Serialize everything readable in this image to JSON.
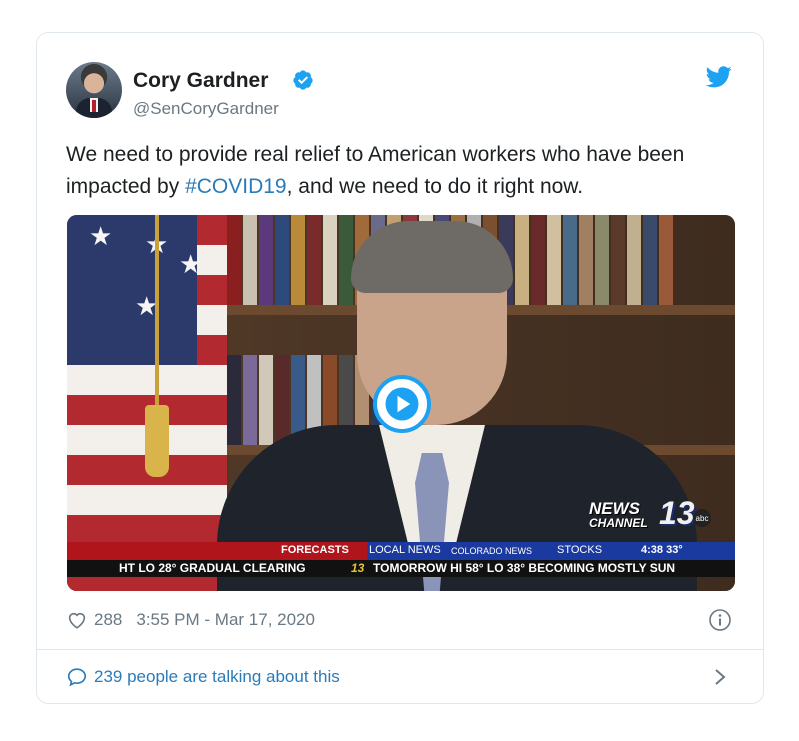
{
  "tweet": {
    "author_name": "Cory Gardner",
    "author_handle": "@SenCoryGardner",
    "text_before": "We need to provide real relief to American workers who have been impacted by ",
    "hashtag": "#COVID19",
    "text_after": ", and we need to do it right now.",
    "likes": "288",
    "timestamp": "3:55 PM - Mar 17, 2020",
    "talking": "239 people are talking about this"
  },
  "video": {
    "logo_news": "NEWS",
    "logo_channel": "CHANNEL",
    "logo_number": "13",
    "logo_network": "abc",
    "ticker_top": {
      "forecasts": "FORECASTS",
      "local_news": "LOCAL NEWS",
      "colorado_news": "COLORADO NEWS",
      "stocks": "STOCKS",
      "time_temp": "4:38 33°"
    },
    "ticker_bottom": {
      "left": "HT LO 28° GRADUAL CLEARING",
      "mid": "13",
      "right": "TOMORROW HI 58° LO 38° BECOMING MOSTLY SUN"
    }
  },
  "icons": {
    "verified": "verified-badge-icon",
    "twitter": "twitter-bird-icon",
    "play": "play-icon",
    "like": "heart-icon",
    "info": "info-icon",
    "reply": "speech-bubble-icon",
    "chevron": "chevron-right-icon"
  },
  "colors": {
    "link_blue": "#2b7bb9",
    "twitter_blue": "#1da1f2",
    "meta_gray": "#697882",
    "border": "#e1e8ed"
  }
}
